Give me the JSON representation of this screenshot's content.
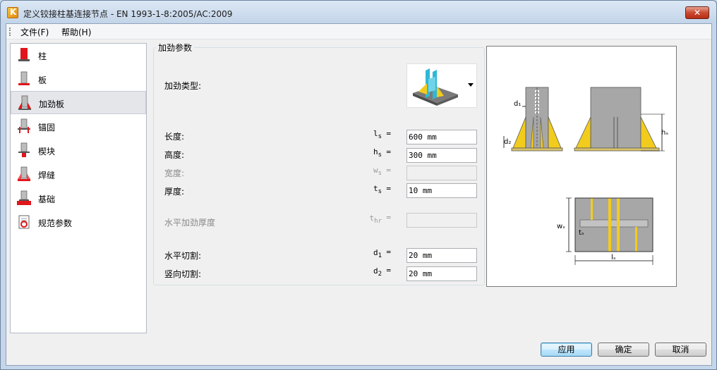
{
  "window": {
    "title": "定义铰接柱基连接节点 - EN 1993-1-8:2005/AC:2009",
    "close_label": "✕"
  },
  "menu": [
    {
      "label": "文件(F)"
    },
    {
      "label": "帮助(H)"
    }
  ],
  "nav": {
    "selected": "加劲板",
    "items": [
      {
        "label": "柱",
        "icon": "column-icon"
      },
      {
        "label": "板",
        "icon": "plate-icon"
      },
      {
        "label": "加劲板",
        "icon": "stiffener-icon"
      },
      {
        "label": "锚固",
        "icon": "anchor-icon"
      },
      {
        "label": "楔块",
        "icon": "shear-key-icon"
      },
      {
        "label": "焊缝",
        "icon": "weld-icon"
      },
      {
        "label": "基础",
        "icon": "foundation-icon"
      },
      {
        "label": "规范参数",
        "icon": "code-params-icon"
      }
    ]
  },
  "group": {
    "title": "加劲参数",
    "stiffener_type_label": "加劲类型:",
    "length": {
      "label": "长度:",
      "symbol": "l",
      "sub": "s",
      "value": "600 mm"
    },
    "height": {
      "label": "高度:",
      "symbol": "h",
      "sub": "s",
      "value": "300 mm"
    },
    "width": {
      "label": "宽度:",
      "symbol": "w",
      "sub": "s",
      "value": ""
    },
    "thickness": {
      "label": "厚度:",
      "symbol": "t",
      "sub": "s",
      "value": "10 mm"
    },
    "horiz_thickness": {
      "label": "水平加劲厚度",
      "symbol": "t",
      "sub": "hr",
      "value": ""
    },
    "horiz_cut": {
      "label": "水平切割:",
      "symbol": "d",
      "sub": "1",
      "value": "20 mm"
    },
    "vert_cut": {
      "label": "竖向切割:",
      "symbol": "d",
      "sub": "2",
      "value": "20 mm"
    },
    "equals": "="
  },
  "preview": {
    "d1": "d₁",
    "d2": "d₂",
    "hs": "hₛ",
    "ws": "wₛ",
    "ts": "tₛ",
    "ls": "lₛ"
  },
  "buttons": {
    "apply": "应用",
    "ok": "确定",
    "cancel": "取消"
  },
  "colors": {
    "accent_red": "#e1161c",
    "stiffener_yellow": "#f2cc1d",
    "steel_gray": "#a7a7a7"
  }
}
